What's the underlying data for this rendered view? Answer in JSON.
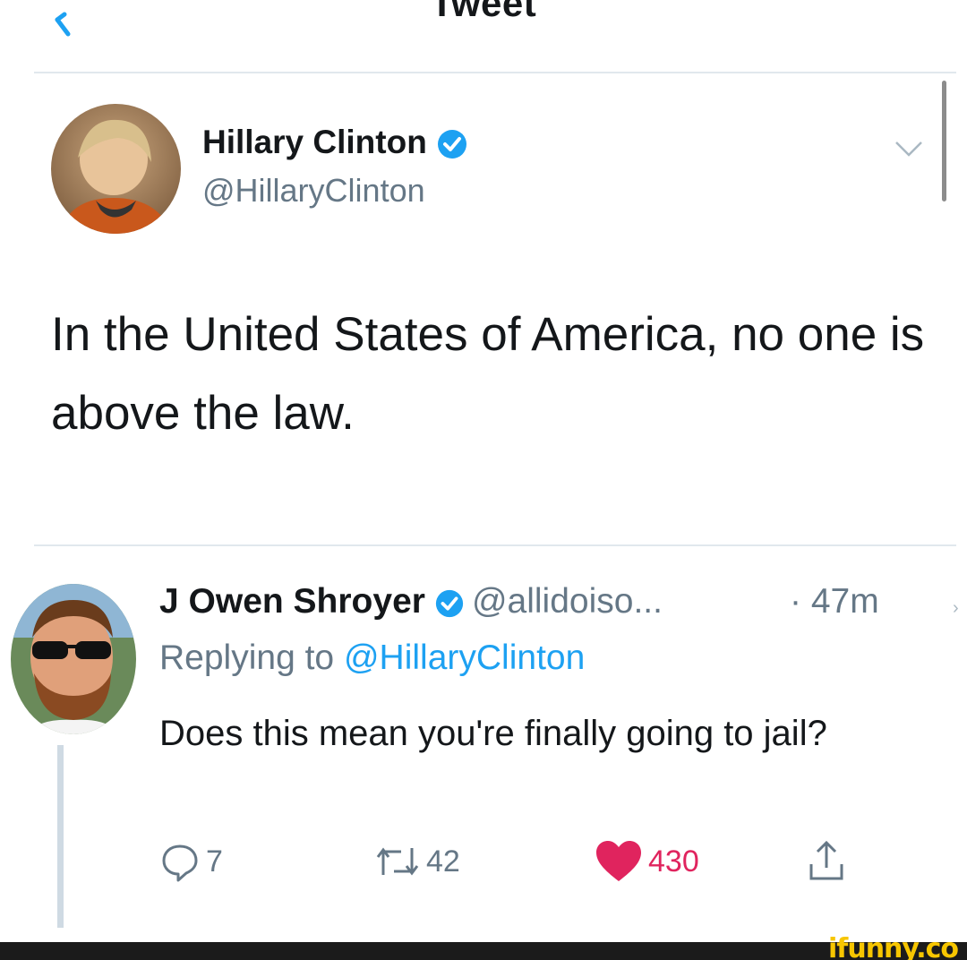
{
  "header": {
    "title": "Tweet",
    "back_icon": "chevron-left-icon"
  },
  "tweet": {
    "author_name": "Hillary Clinton",
    "author_handle": "@HillaryClinton",
    "verified_icon": "verified-badge-icon",
    "more_icon": "chevron-down-icon",
    "text": "In the United States of America, no one is above the law."
  },
  "reply": {
    "author_name": "J Owen Shroyer",
    "author_handle": "@allidoiso...",
    "time": "· 47m",
    "replying_prefix": "Replying to",
    "replying_handle": "@HillaryClinton",
    "text": "Does this mean you're finally going to jail?",
    "actions": {
      "reply_count": "7",
      "retweet_count": "42",
      "like_count": "430"
    }
  },
  "watermark": "ifunny.co",
  "colors": {
    "accent": "#1da1f2",
    "like": "#e0245e",
    "muted": "#657786",
    "divider": "#e1e8ed"
  }
}
